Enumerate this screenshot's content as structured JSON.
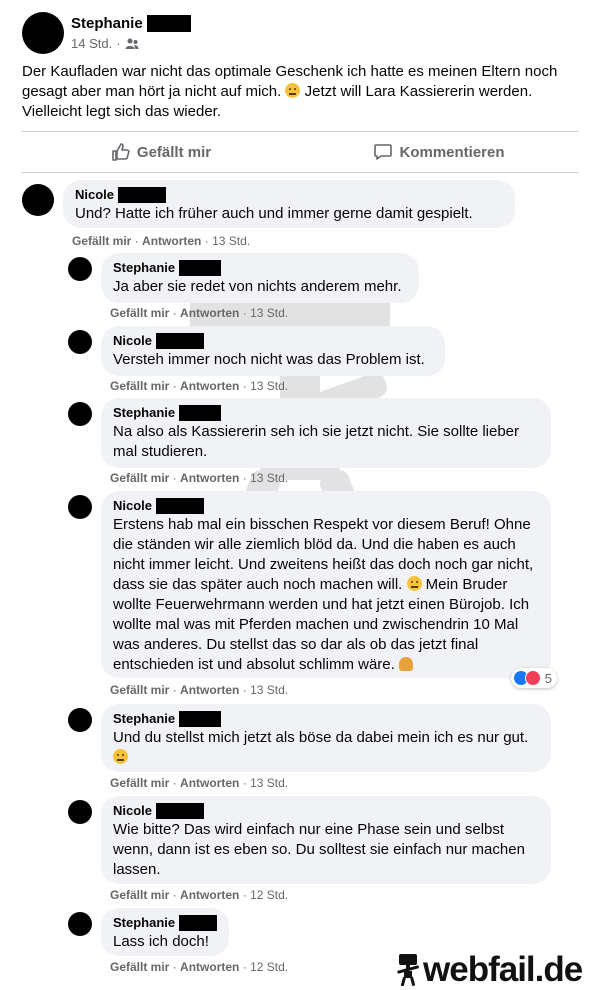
{
  "post": {
    "author": "Stephanie",
    "time": "14 Std.",
    "separator": "·",
    "text": "Der Kaufladen war nicht das optimale Geschenk ich hatte es meinen Eltern noch gesagt aber man hört ja nicht auf mich.",
    "text_after_emoji": " Jetzt will Lara Kassiererin werden. Vielleicht legt sich das wieder.",
    "audience_icon": "friends-icon"
  },
  "actions": {
    "like": "Gefällt mir",
    "comment": "Kommentieren"
  },
  "comment_actions": {
    "like": "Gefällt mir",
    "reply": "Antworten",
    "sep": "·"
  },
  "comments": [
    {
      "name": "Nicole",
      "text": "Und? Hatte ich früher auch und immer gerne damit gespielt.",
      "time": "13 Std."
    },
    {
      "name": "Stephanie",
      "text": "Ja aber sie redet von nichts anderem mehr.",
      "time": "13 Std."
    },
    {
      "name": "Nicole",
      "text": "Versteh immer noch nicht was das Problem ist.",
      "time": "13 Std."
    },
    {
      "name": "Stephanie",
      "text": "Na also als Kassiererin seh ich sie jetzt nicht. Sie sollte lieber mal studieren.",
      "time": "13 Std."
    },
    {
      "name": "Nicole",
      "text": "Erstens hab mal ein bisschen Respekt vor diesem Beruf! Ohne die ständen wir alle ziemlich blöd da. Und die haben es auch nicht immer leicht. Und zweitens heißt das doch noch gar nicht, dass sie das später auch noch machen will.",
      "text2": " Mein Bruder wollte Feuerwehrmann werden und hat jetzt einen Bürojob. Ich wollte mal was mit Pferden machen und zwischendrin 10 Mal was anderes. Du stellst das so dar als ob das jetzt final entschieden ist und absolut schlimm wäre.",
      "time": "13 Std.",
      "reaction_count": "5"
    },
    {
      "name": "Stephanie",
      "text": "Und du stellst mich jetzt als böse da dabei mein ich es nur gut.",
      "time": "13 Std."
    },
    {
      "name": "Nicole",
      "text": "Wie bitte? Das wird einfach nur eine Phase sein und selbst wenn, dann ist es eben so. Du solltest sie einfach nur machen lassen.",
      "time": "12 Std."
    },
    {
      "name": "Stephanie",
      "text": "Lass ich doch!",
      "time": "12 Std."
    }
  ],
  "watermark": "webfail.de"
}
